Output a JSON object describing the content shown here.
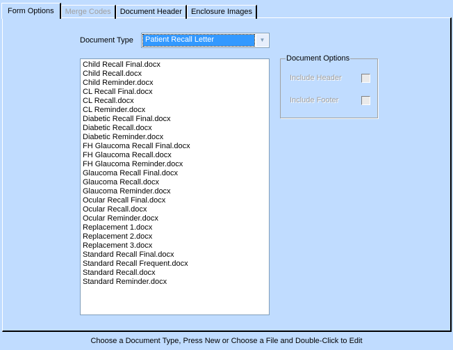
{
  "tabs": [
    {
      "label": "Form Options",
      "state": "active"
    },
    {
      "label": "Merge Codes",
      "state": "disabled"
    },
    {
      "label": "Document Header",
      "state": "normal"
    },
    {
      "label": "Enclosure Images",
      "state": "normal"
    }
  ],
  "document_type": {
    "label": "Document Type",
    "value": "Patient Recall Letter"
  },
  "files": [
    "Child Recall Final.docx",
    "Child Recall.docx",
    "Child Reminder.docx",
    "CL Recall Final.docx",
    "CL Recall.docx",
    "CL Reminder.docx",
    "Diabetic Recall Final.docx",
    "Diabetic Recall.docx",
    "Diabetic Reminder.docx",
    "FH Glaucoma Recall Final.docx",
    "FH Glaucoma Recall.docx",
    "FH Glaucoma Reminder.docx",
    "Glaucoma Recall Final.docx",
    "Glaucoma Recall.docx",
    "Glaucoma Reminder.docx",
    "Ocular Recall Final.docx",
    "Ocular Recall.docx",
    "Ocular Reminder.docx",
    "Replacement 1.docx",
    "Replacement 2.docx",
    "Replacement 3.docx",
    "Standard Recall Final.docx",
    "Standard Recall Frequent.docx",
    "Standard Recall.docx",
    "Standard Reminder.docx"
  ],
  "document_options": {
    "title": "Document Options",
    "include_header": {
      "label": "Include Header",
      "checked": false,
      "enabled": false
    },
    "include_footer": {
      "label": "Include Footer",
      "checked": false,
      "enabled": false
    }
  },
  "status": "Choose a Document Type, Press New or Choose a File and Double-Click to Edit",
  "colors": {
    "background": "#c0dcff",
    "selection": "#3399ff"
  }
}
